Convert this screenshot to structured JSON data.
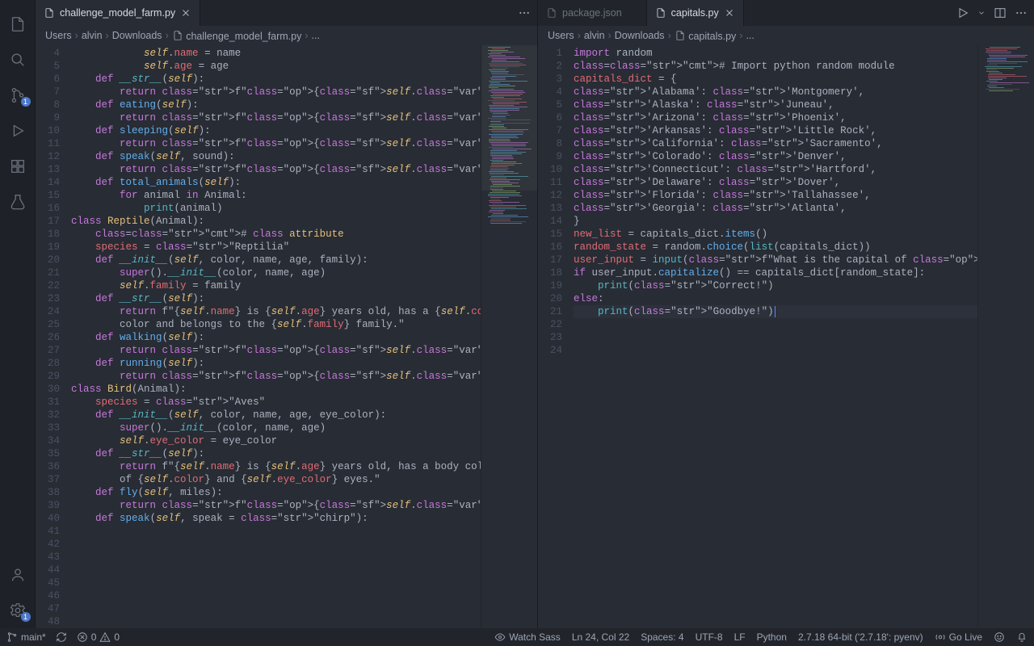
{
  "tabs_left": [
    {
      "label": "challenge_model_farm.py",
      "active": true
    }
  ],
  "tabs_right": [
    {
      "label": "package.json",
      "active": false
    },
    {
      "label": "capitals.py",
      "active": true
    }
  ],
  "breadcrumbs_left": [
    "Users",
    "alvin",
    "Downloads",
    "challenge_model_farm.py",
    "..."
  ],
  "breadcrumbs_right": [
    "Users",
    "alvin",
    "Downloads",
    "capitals.py",
    "..."
  ],
  "left_start_line": 4,
  "left_code": [
    "            self.name = name",
    "            self.age = age",
    "",
    "    def __str__(self):",
    "        return f\"{self.name} says hello\"",
    "",
    "    def eating(self):",
    "        return f\"{self.name} is eating\"",
    "    def sleeping(self):",
    "        return f\"{self.name} is sleeping\"",
    "    def speak(self, sound):",
    "        return f\"{self.name} produces a {sound}\"",
    "    def total_animals(self):",
    "        for animal in Animal:",
    "            print(animal)",
    "",
    "class Reptile(Animal):",
    "    # class attribute",
    "    species = \"Reptilia\"",
    "",
    "    def __init__(self, color, name, age, family):",
    "        super().__init__(color, name, age)",
    "        self.family = family",
    "",
    "    def __str__(self):",
    "        return f\"{self.name} is {self.age} years old, has a {self.color}",
    "        color and belongs to the {self.family} family.\"",
    "    def walking(self):",
    "        return f\"{self.name} is walking\"",
    "    def running(self):",
    "        return f\"{self.name} is running\"",
    "",
    "class Bird(Animal):",
    "    species = \"Aves\"",
    "",
    "    def __init__(self, color, name, age, eye_color):",
    "        super().__init__(color, name, age)",
    "        self.eye_color = eye_color",
    "",
    "    def __str__(self):",
    "        return f\"{self.name} is {self.age} years old, has a body color",
    "        of {self.color} and {self.eye_color} eyes.\"",
    "    def fly(self, miles):",
    "        return f\"{self.name} has travelled {miles} miles\"",
    "",
    "    def speak(self, speak = \"chirp\"):"
  ],
  "right_start_line": 1,
  "right_code": [
    "import random",
    "# Import python random module",
    "",
    "capitals_dict = {",
    "'Alabama': 'Montgomery',",
    "'Alaska': 'Juneau',",
    "'Arizona': 'Phoenix',",
    "'Arkansas': 'Little Rock',",
    "'California': 'Sacramento',",
    "'Colorado': 'Denver',",
    "'Connecticut': 'Hartford',",
    "'Delaware': 'Dover',",
    "'Florida': 'Tallahassee',",
    "'Georgia': 'Atlanta',",
    "}",
    "new_list = capitals_dict.items()",
    "random_state = random.choice(list(capitals_dict))",
    "",
    "user_input = input(f\"What is the capital of {random_state} ?\")",
    "",
    "if user_input.capitalize() == capitals_dict[random_state]:",
    "    print(\"Correct!\")",
    "else:",
    "    print(\"Goodbye!\")"
  ],
  "right_highlight_line": 24,
  "left_highlight_line": 19,
  "status": {
    "branch": "main*",
    "problems_errors": "0",
    "problems_warnings": "0",
    "watch_sass": "Watch Sass",
    "cursor": "Ln 24, Col 22",
    "spaces": "Spaces: 4",
    "encoding": "UTF-8",
    "eol": "LF",
    "language": "Python",
    "interpreter": "2.7.18 64-bit ('2.7.18': pyenv)",
    "go_live": "Go Live",
    "source_control_badge": "1",
    "settings_badge": "1"
  }
}
